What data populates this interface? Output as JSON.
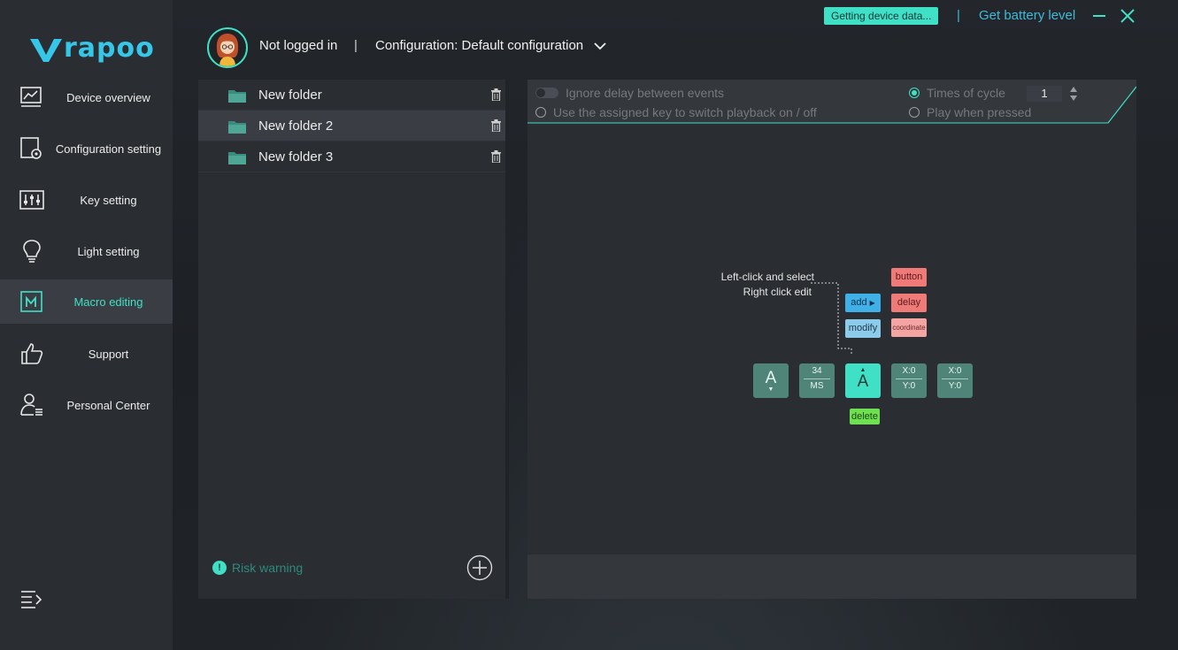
{
  "brand": {
    "name": "rapoo"
  },
  "sidebar": {
    "items": [
      {
        "label": "Device overview"
      },
      {
        "label": "Configuration setting"
      },
      {
        "label": "Key setting"
      },
      {
        "label": "Light setting"
      },
      {
        "label": "Macro editing"
      },
      {
        "label": "Support"
      },
      {
        "label": "Personal Center"
      }
    ],
    "active_index": 4
  },
  "header": {
    "user": "Not logged in",
    "separator": "|",
    "configuration": "Configuration: Default configuration",
    "status": "Getting device data...",
    "separator2": "|",
    "battery": "Get battery level"
  },
  "folders": {
    "items": [
      {
        "name": "New folder"
      },
      {
        "name": "New folder 2"
      },
      {
        "name": "New folder 3"
      }
    ],
    "selected_index": 1,
    "risk_icon": "!",
    "risk_warning": "Risk warning"
  },
  "options": {
    "ignore_delay": "Ignore delay between events",
    "assigned_key": "Use the assigned key to switch playback on / off",
    "times_of_cycle": "Times of cycle",
    "play_when_pressed": "Play when pressed",
    "cycle_value": "1"
  },
  "guide": {
    "hint_left_click": "Left-click and select",
    "hint_right_click": "Right click edit",
    "add": "add",
    "modify": "modify",
    "button": "button",
    "delay": "delay",
    "coordinate": "coordinate",
    "delete": "delete",
    "tiles": [
      {
        "key": "A"
      },
      {
        "value": "34",
        "unit": "MS"
      },
      {
        "key": "A"
      },
      {
        "x": "X:0",
        "y": "Y:0"
      },
      {
        "x": "X:0",
        "y": "Y:0"
      }
    ]
  },
  "colors": {
    "accent": "#3fe0c5",
    "link": "#3fb9d8",
    "sidebar_bg": "#2a2d32",
    "panel_bg": "#2a2d32"
  }
}
